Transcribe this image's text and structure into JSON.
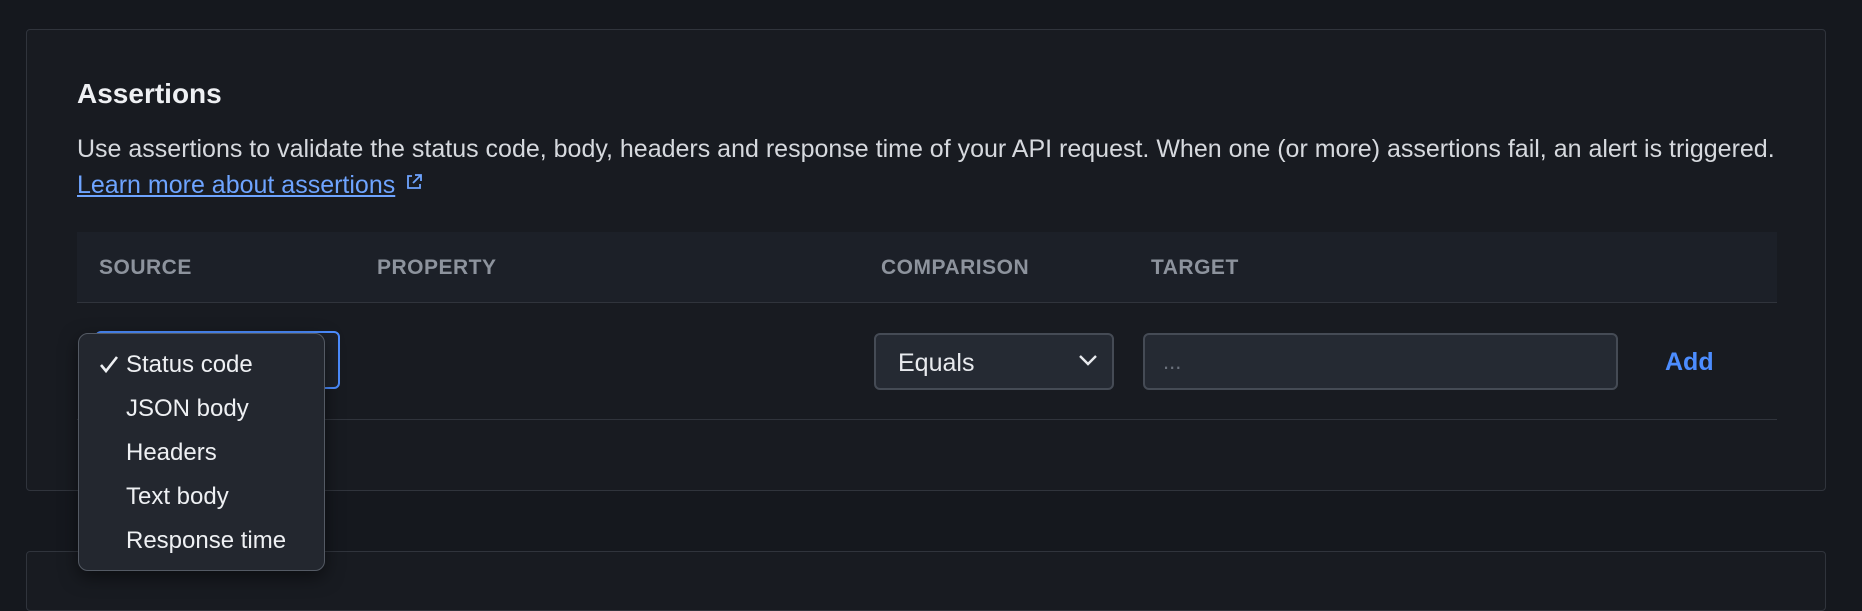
{
  "section": {
    "title": "Assertions",
    "description": "Use assertions to validate the status code, body, headers and response time of your API request. When one (or more) assertions fail, an alert is triggered.",
    "learn_more_label": "Learn more about assertions",
    "learn_more_icon": "external-link-icon"
  },
  "table": {
    "headers": [
      "SOURCE",
      "PROPERTY",
      "COMPARISON",
      "TARGET"
    ],
    "row": {
      "comparison_value": "Equals",
      "target_placeholder": "...",
      "add_label": "Add"
    }
  },
  "source_dropdown": {
    "selected": "Status code",
    "options": [
      "Status code",
      "JSON body",
      "Headers",
      "Text body",
      "Response time"
    ]
  },
  "colors": {
    "background": "#15181e",
    "accent": "#4c8dff",
    "link": "#6ea4ff"
  }
}
